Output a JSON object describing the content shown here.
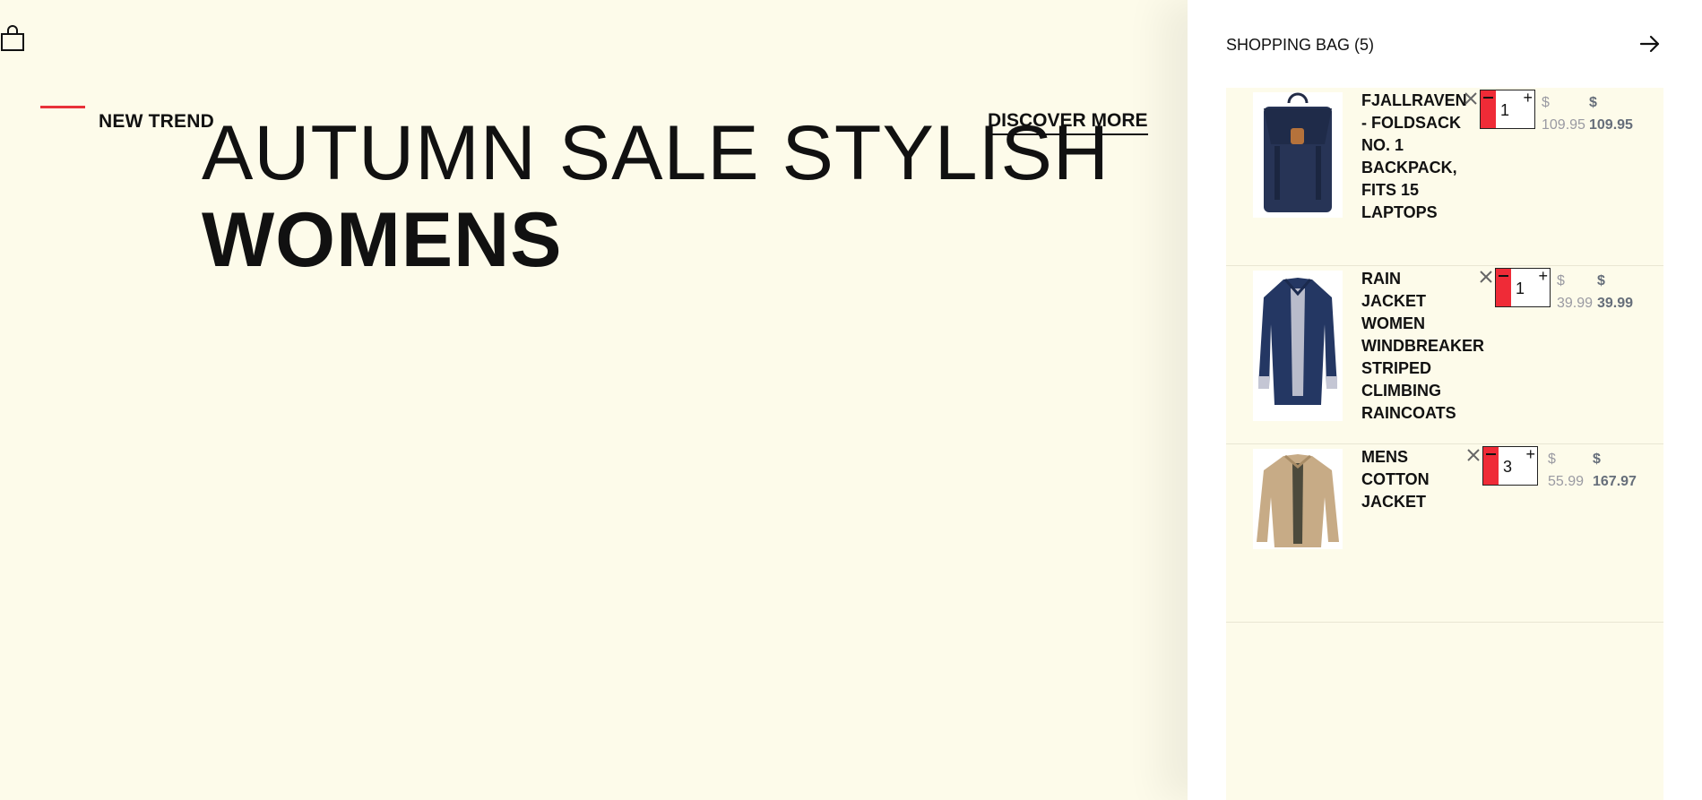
{
  "hero": {
    "kicker": "NEW TREND",
    "title": "AUTUMN SALE STYLISH",
    "subtitle": "WOMENS",
    "cta": "DISCOVER MORE",
    "accent_color": "#e8313a"
  },
  "cart": {
    "title": "SHOPPING BAG (5)",
    "close_icon": "arrow-right-icon",
    "items": [
      {
        "name": "FJALLRAVEN - FOLDSACK NO. 1 BACKPACK, FITS 15 LAPTOPS",
        "qty": "1",
        "currency": "$",
        "unit_price": "109.95",
        "total_price": "109.95"
      },
      {
        "name": "RAIN JACKET WOMEN WINDBREAKER STRIPED CLIMBING RAINCOATS",
        "qty": "1",
        "currency": "$",
        "unit_price": "39.99",
        "total_price": "39.99"
      },
      {
        "name": "MENS COTTON JACKET",
        "qty": "3",
        "currency": "$",
        "unit_price": "55.99",
        "total_price": "167.97"
      }
    ]
  },
  "icons": {
    "bag": "shopping-bag-icon",
    "remove": "close-icon",
    "decrement": "minus-icon",
    "increment": "plus-icon"
  }
}
